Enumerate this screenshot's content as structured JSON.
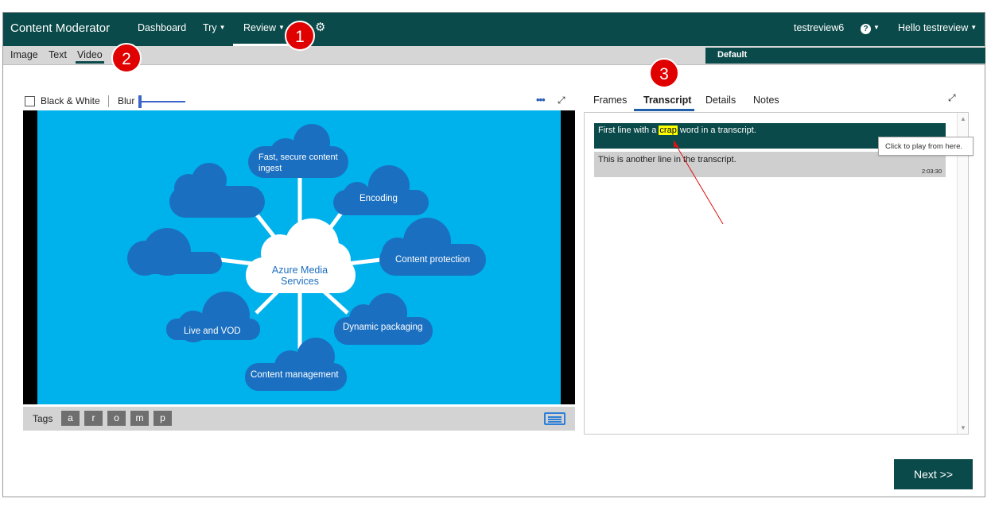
{
  "app": {
    "title": "Content Moderator"
  },
  "nav": {
    "items": [
      {
        "label": "Dashboard",
        "caret": false
      },
      {
        "label": "Try",
        "caret": true
      },
      {
        "label": "Review",
        "caret": true
      }
    ],
    "team": "testreview6",
    "help_label": "?",
    "user": "Hello testreview"
  },
  "media_tabs": [
    "Image",
    "Text",
    "Video"
  ],
  "active_media_tab": "Video",
  "queue": {
    "name": "Default"
  },
  "markers": [
    "1",
    "2",
    "3"
  ],
  "video_controls": {
    "black_white_label": "Black & White",
    "black_white_checked": false,
    "blur_label": "Blur",
    "blur_level": 0
  },
  "slide": {
    "center": "Azure Media Services",
    "bubbles": [
      "Fast, secure content ingest",
      "Encoding",
      "Content protection",
      "Dynamic packaging",
      "Content management",
      "Live and VOD"
    ]
  },
  "tags": {
    "label": "Tags",
    "items": [
      "a",
      "r",
      "o",
      "m",
      "p"
    ]
  },
  "panel_tabs": [
    "Frames",
    "Transcript",
    "Details",
    "Notes"
  ],
  "active_panel_tab": "Transcript",
  "transcript": [
    {
      "before": "First line with a ",
      "flagged": "crap",
      "after": " word in a transcript.",
      "time": ""
    },
    {
      "before": "This is another line in the transcript.",
      "flagged": "",
      "after": "",
      "time": "2:03:30"
    }
  ],
  "tooltip": "Click to play from here.",
  "next_button": "Next >>",
  "colors": {
    "primary": "#0b4a4a",
    "accent_blue": "#1f5fa8",
    "slide_bg": "#00b2ec",
    "cloud": "#1b6fc0",
    "highlight": "#ffff00",
    "marker": "#e00000"
  }
}
